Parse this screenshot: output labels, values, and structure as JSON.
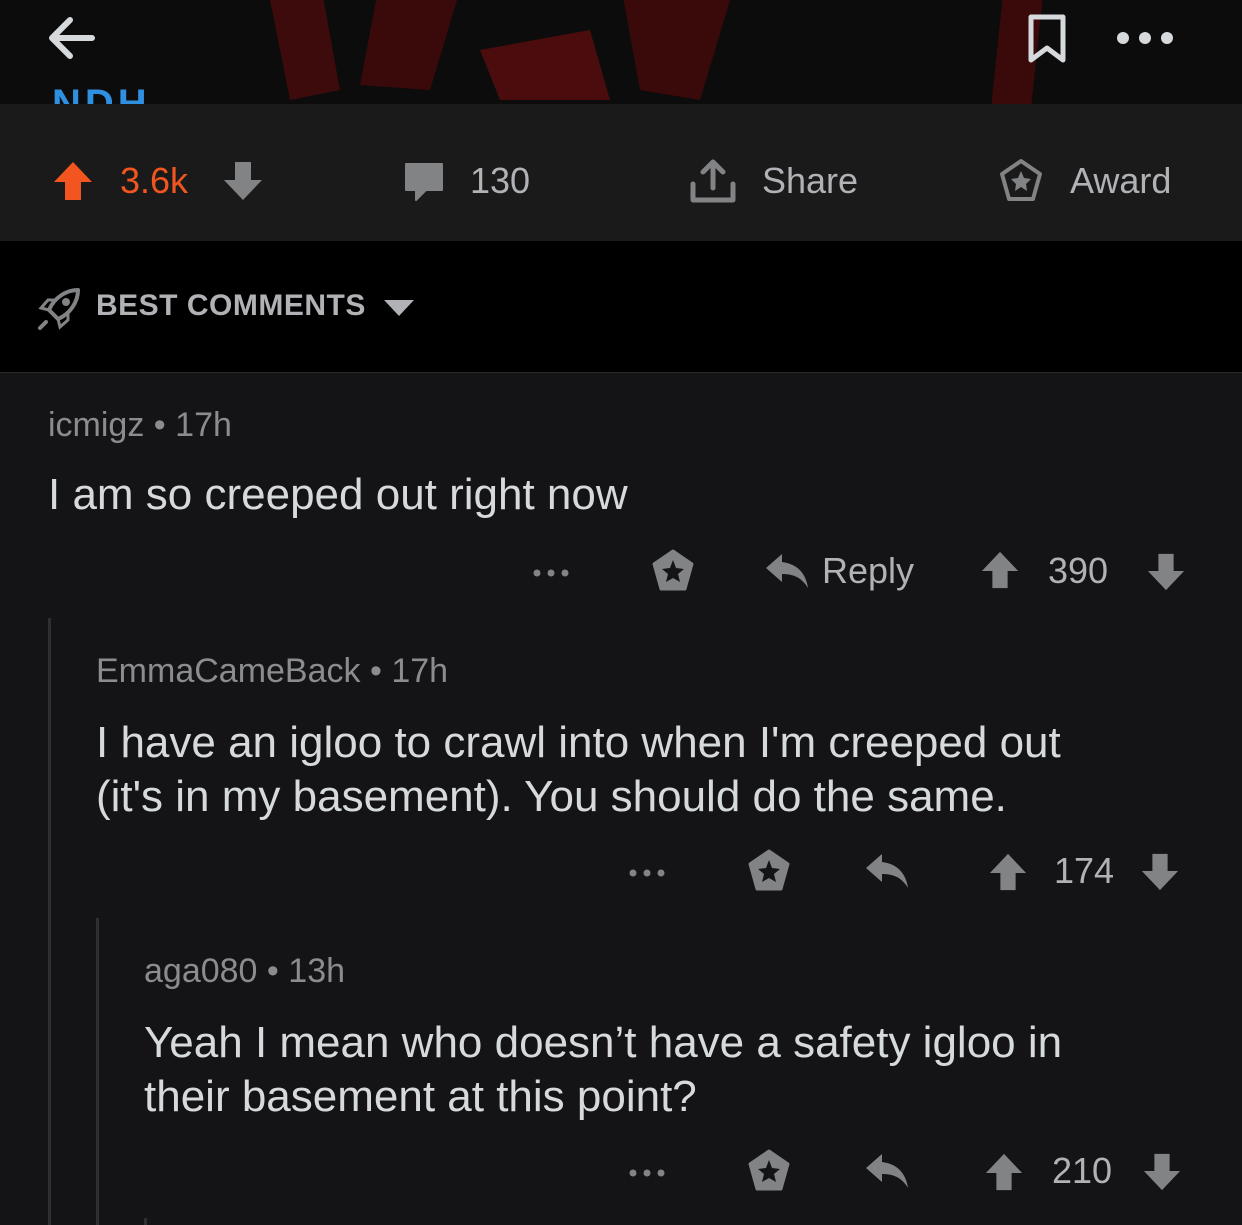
{
  "header": {
    "cut_title": "NDH",
    "back_icon": "back-arrow-icon",
    "save_icon": "bookmark-icon",
    "more_icon": "more-horizontal-icon"
  },
  "post_actions": {
    "upvotes": "3.6k",
    "comments": "130",
    "share_label": "Share",
    "award_label": "Award",
    "accent_color": "#f2551f"
  },
  "sort": {
    "label": "BEST COMMENTS"
  },
  "comments": [
    {
      "author": "icmigz",
      "age": "17h",
      "body": [
        "I am so creeped out right now"
      ],
      "reply_label": "Reply",
      "score": "390"
    },
    {
      "author": "EmmaCameBack",
      "age": "17h",
      "body": [
        "I have an igloo to crawl into when I'm creeped out",
        "(it's in my basement). You should do the same."
      ],
      "score": "174"
    },
    {
      "author": "aga080",
      "age": "13h",
      "body": [
        "Yeah I mean who doesn’t have a safety igloo in",
        "their basement at this point?"
      ],
      "score": "210"
    }
  ],
  "separator": "•"
}
